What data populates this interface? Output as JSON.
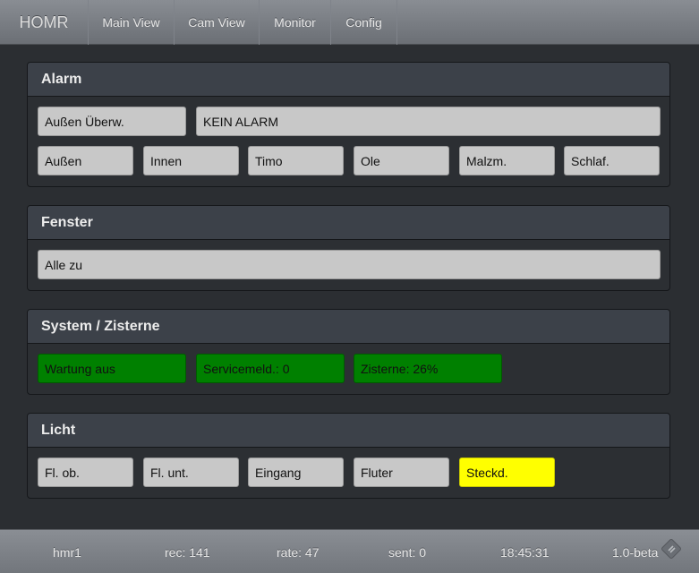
{
  "nav": {
    "brand": "HOMR",
    "links": [
      "Main View",
      "Cam View",
      "Monitor",
      "Config"
    ]
  },
  "panels": {
    "alarm": {
      "title": "Alarm",
      "mode_button": "Außen Überw.",
      "status": "KEIN ALARM",
      "zones": [
        "Außen",
        "Innen",
        "Timo",
        "Ole",
        "Malzm.",
        "Schlaf."
      ]
    },
    "fenster": {
      "title": "Fenster",
      "status": "Alle zu"
    },
    "system": {
      "title": "System / Zisterne",
      "items": [
        "Wartung aus",
        "Servicemeld.: 0",
        "Zisterne: 26%"
      ],
      "status_color": "#008000"
    },
    "licht": {
      "title": "Licht",
      "items": [
        "Fl. ob.",
        "Fl. unt.",
        "Eingang",
        "Fluter",
        "Steckd."
      ],
      "active_color": "#ffff00"
    }
  },
  "footer": {
    "host": "hmr1",
    "rec": "rec: 141",
    "rate": "rate: 47",
    "sent": "sent: 0",
    "time": "18:45:31",
    "version": "1.0-beta",
    "icon": "resize-corner-icon"
  }
}
